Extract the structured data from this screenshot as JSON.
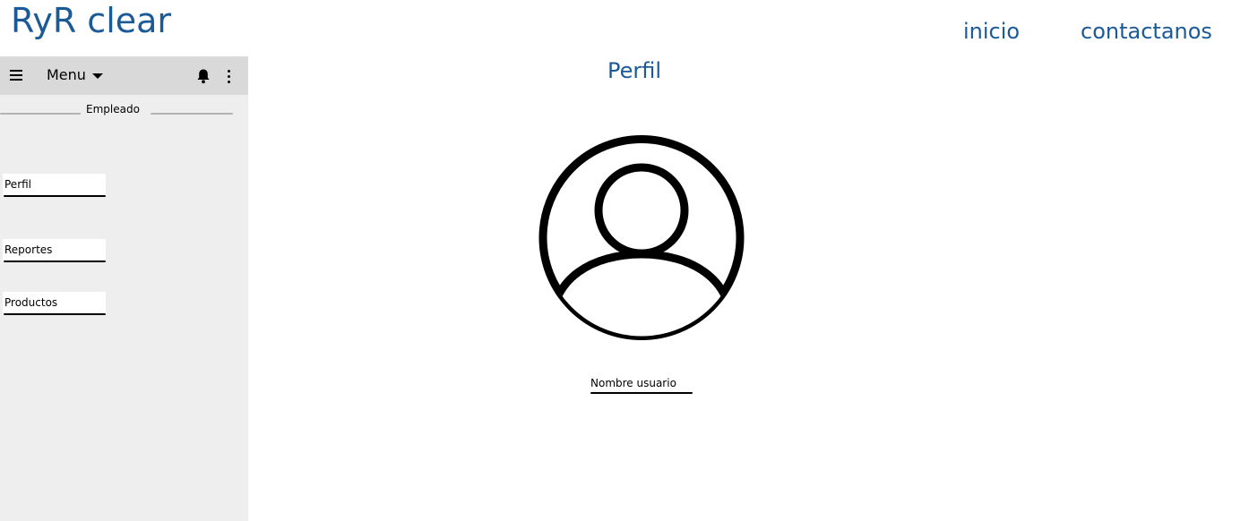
{
  "header": {
    "brand": "RyR clear",
    "nav": {
      "inicio": "inicio",
      "contactanos": "contactanos"
    },
    "accent_color": "#1a5a96"
  },
  "sidebar": {
    "menu_label": "Menu",
    "section_label": "Empleado",
    "items": [
      {
        "label": "Perfil"
      },
      {
        "label": "Reportes"
      },
      {
        "label": "Productos"
      }
    ],
    "icons": [
      "hamburger-icon",
      "caret-down-icon",
      "bell-icon",
      "kebab-menu-icon"
    ],
    "background": "#eeeeee",
    "menubar_background": "#d9d9d9"
  },
  "main": {
    "title": "Perfil",
    "avatar_icon": "user-avatar-icon",
    "username_label": "Nombre usuario"
  }
}
